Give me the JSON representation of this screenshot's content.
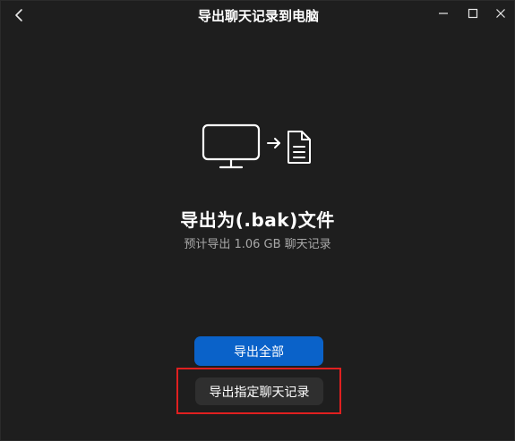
{
  "window": {
    "title": "导出聊天记录到电脑"
  },
  "titlebar": {
    "back_icon": "chevron-left-icon",
    "minimize_icon": "minimize-icon",
    "maximize_icon": "maximize-icon",
    "close_icon": "close-icon"
  },
  "illustration": {
    "monitor_icon": "monitor-icon",
    "arrow_icon": "arrow-right-icon",
    "file_icon": "document-icon"
  },
  "main": {
    "heading": "导出为(.bak)文件",
    "subtext": "预计导出 1.06 GB 聊天记录"
  },
  "actions": {
    "export_all_label": "导出全部",
    "export_selected_label": "导出指定聊天记录"
  },
  "colors": {
    "background": "#1e1e1e",
    "primary_button": "#0a62c9",
    "secondary_button": "#2f2f2f",
    "highlight_border": "#e02020",
    "subtext": "#a8a8a8"
  }
}
